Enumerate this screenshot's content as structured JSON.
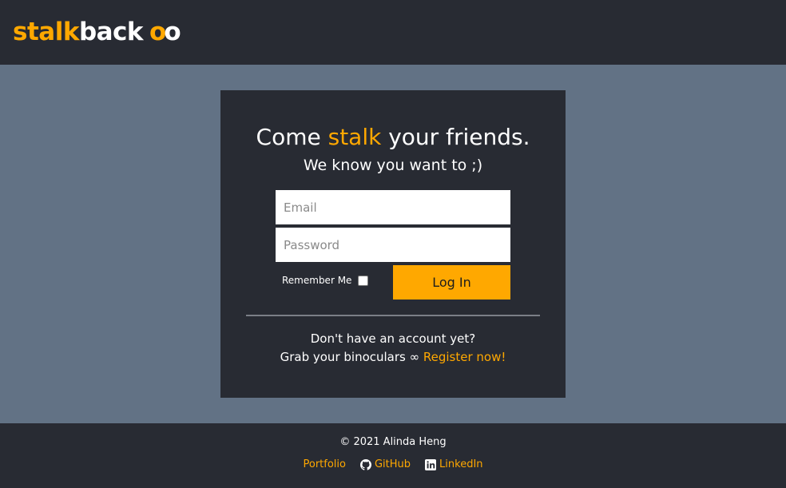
{
  "header": {
    "logo_part1": "stalk",
    "logo_part2": "back",
    "logo_mark_1": "o",
    "logo_mark_2": "o"
  },
  "card": {
    "headline_pre": "Come ",
    "headline_accent": "stalk",
    "headline_post": " your friends.",
    "subline": "We know you want to ;)",
    "email_placeholder": "Email",
    "password_placeholder": "Password",
    "remember_label": "Remember Me",
    "remember_checked": false,
    "login_label": "Log In",
    "no_account_text": "Don't have an account yet?",
    "grab_text": "Grab your binoculars ∞ ",
    "register_label": "Register now!"
  },
  "footer": {
    "copyright": "© 2021 Alinda Heng",
    "links": {
      "portfolio": "Portfolio",
      "github": "GitHub",
      "linkedin": "LinkedIn"
    }
  },
  "colors": {
    "accent": "#ffa800",
    "dark_panel": "#282b33",
    "page_background": "#627285"
  },
  "icons": {
    "github": "github-icon",
    "linkedin": "linkedin-icon"
  }
}
